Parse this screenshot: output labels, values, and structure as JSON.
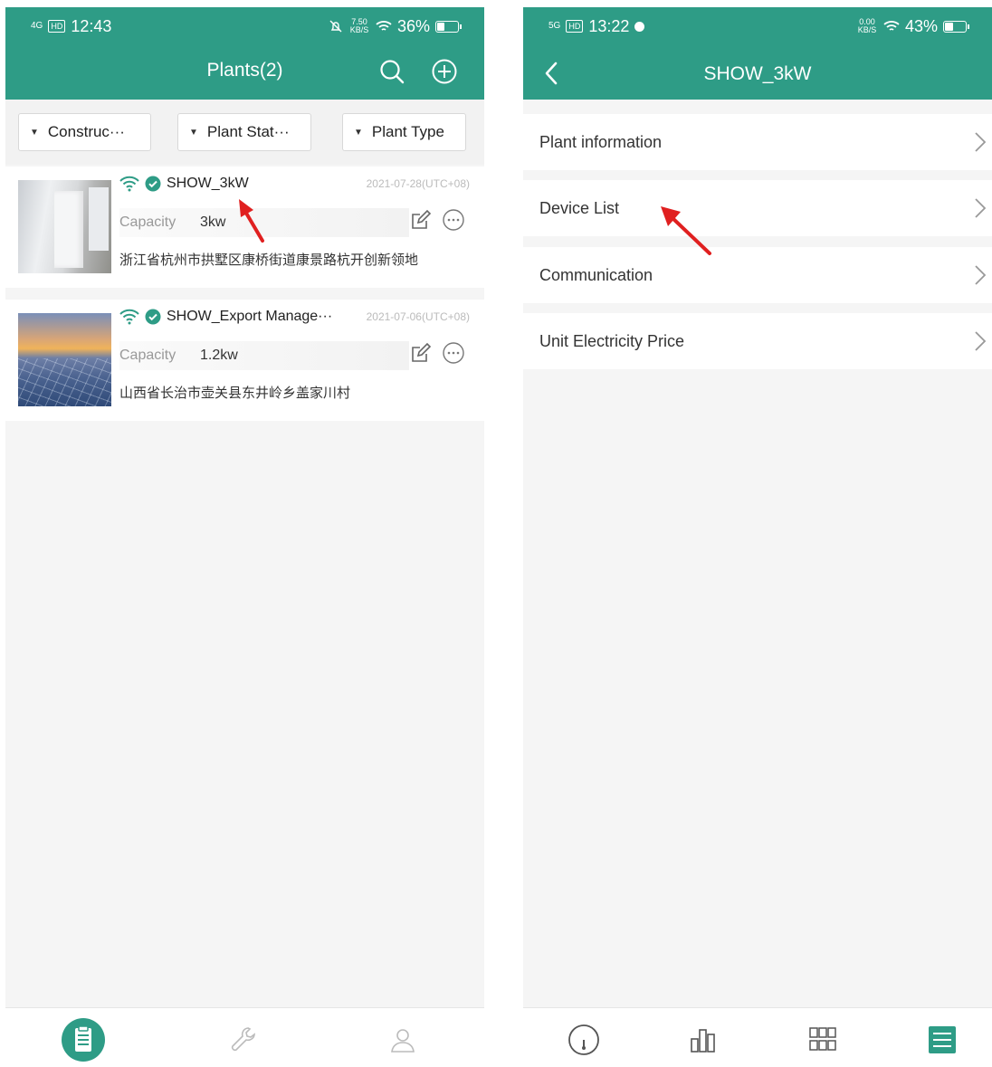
{
  "left": {
    "status": {
      "time": "12:43",
      "network": "4G",
      "speed": "7.50 KB/S",
      "battery": "36%",
      "battery_level": 0.36
    },
    "header": {
      "title": "Plants(2)"
    },
    "filters": [
      "Construc···",
      "Plant Stat···",
      "Plant Type"
    ],
    "plants": [
      {
        "name": "SHOW_3kW",
        "date": "2021-07-28(UTC+08)",
        "capacity_label": "Capacity",
        "capacity": "3kw",
        "address": "浙江省杭州市拱墅区康桥街道康景路杭开创新领地"
      },
      {
        "name": "SHOW_Export Manage···",
        "date": "2021-07-06(UTC+08)",
        "capacity_label": "Capacity",
        "capacity": "1.2kw",
        "address": "山西省长治市壶关县东井岭乡盖家川村"
      }
    ],
    "tabs": [
      "plant-list-tab-icon",
      "wrench-icon",
      "user-icon"
    ]
  },
  "right": {
    "status": {
      "time": "13:22",
      "network": "5G",
      "speed": "0.00 KB/S",
      "battery": "43%",
      "battery_level": 0.43
    },
    "header": {
      "title": "SHOW_3kW"
    },
    "menu": [
      "Plant information",
      "Device List",
      "Communication",
      "Unit Electricity Price"
    ],
    "tabs": [
      "gauge-icon",
      "bar-chart-icon",
      "grid-icon",
      "list-icon"
    ]
  },
  "colors": {
    "brand": "#2e9c86",
    "annotation_arrow": "#e02020"
  }
}
